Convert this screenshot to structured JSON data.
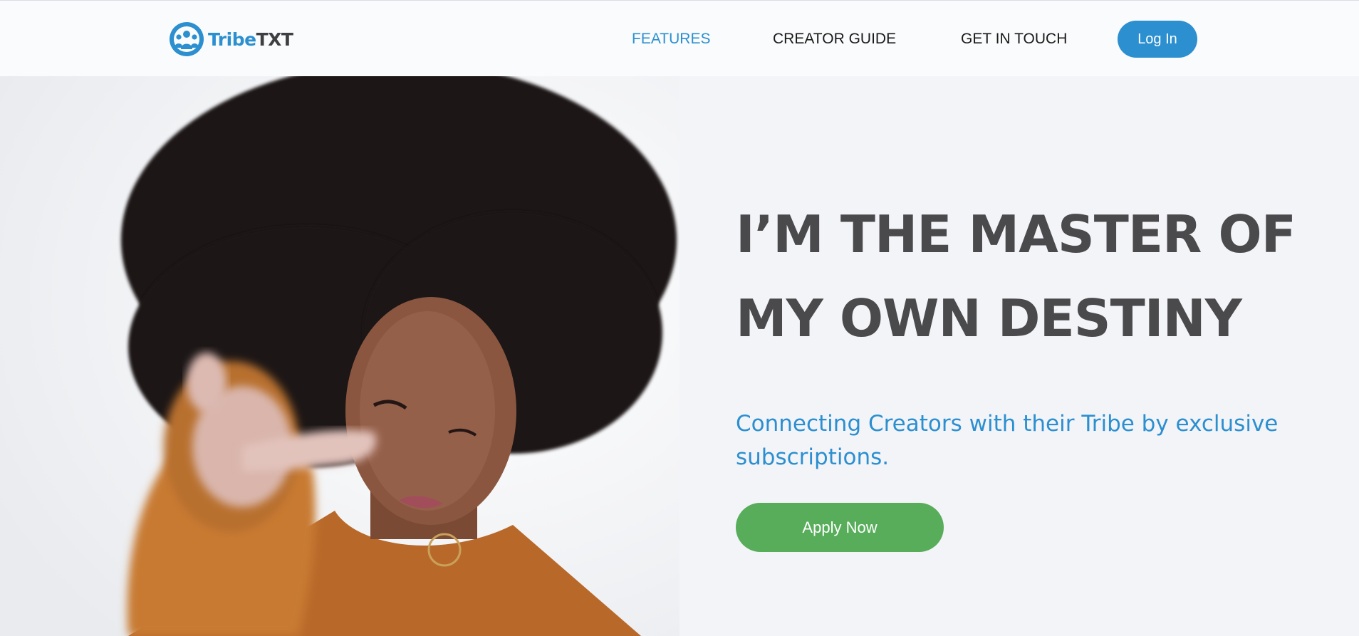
{
  "brand": {
    "name_part1": "Tribe",
    "name_part2": "TXT",
    "logo_icon": "people-group-icon",
    "primary_color": "#2b8fd0",
    "dark_color": "#3d3f42"
  },
  "nav": {
    "items": [
      {
        "label": "FEATURES",
        "active": true
      },
      {
        "label": "CREATOR GUIDE",
        "active": false
      },
      {
        "label": "GET IN TOUCH",
        "active": false
      }
    ],
    "login_label": "Log In"
  },
  "hero": {
    "headline_line1": "I’M THE MASTER OF",
    "headline_line2": "MY OWN DESTINY",
    "subheadline": "Connecting Creators with their Tribe by exclusive subscriptions.",
    "cta_label": "Apply Now",
    "cta_color": "#57ad5a",
    "image_subject": "woman-pointing-photo"
  }
}
